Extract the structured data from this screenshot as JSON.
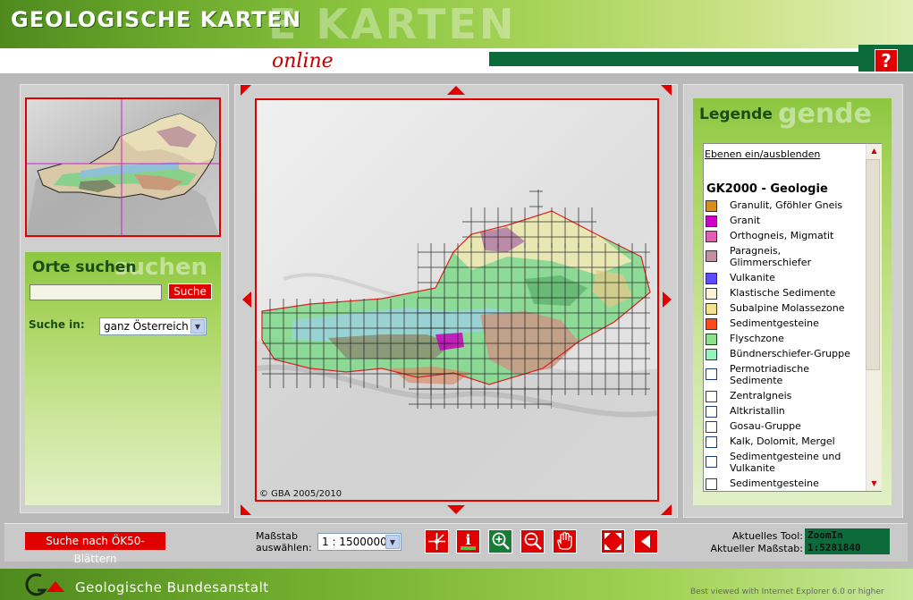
{
  "header": {
    "title": "GEOLOGISCHE KARTEN",
    "title_ghost": "E KARTEN",
    "subtitle": "online",
    "help_label": "?"
  },
  "search": {
    "title": "Orte suchen",
    "title_ghost": "suchen",
    "input_value": "",
    "button_label": "Suche",
    "search_in_label": "Suche in:",
    "region_selected": "ganz Österreich"
  },
  "map": {
    "copyright": "© GBA 2005/2010"
  },
  "legend": {
    "title": "Legende",
    "title_ghost": "gende",
    "toggle_label": "Ebenen ein/ausblenden",
    "layer_title": "GK2000 - Geologie",
    "items": [
      {
        "label": "Granulit, Gföhler Gneis",
        "color": "#d98d1c"
      },
      {
        "label": "Granit",
        "color": "#d100c8"
      },
      {
        "label": "Orthogneis, Migmatit",
        "color": "#e65bb4"
      },
      {
        "label": "Paragneis, Glimmerschiefer",
        "color": "#c88fa3"
      },
      {
        "label": "Vulkanite",
        "color": "#5b4cff"
      },
      {
        "label": "Klastische Sedimente",
        "color": "#fbf3d6"
      },
      {
        "label": "Subalpine Molassezone",
        "color": "#f4e28f"
      },
      {
        "label": "Sedimentgesteine",
        "color": "#ff4a1a"
      },
      {
        "label": "Flyschzone",
        "color": "#8fe08a"
      },
      {
        "label": "Bündnerschiefer-Gruppe",
        "color": "#93f5b9"
      },
      {
        "label": "Permotriadische Sedimente",
        "color": "#ffffff"
      },
      {
        "label": "Zentralgneis",
        "color": "#ffffff"
      },
      {
        "label": "Altkristallin",
        "color": "#ffffff"
      },
      {
        "label": "Gosau-Gruppe",
        "color": "#ffffff"
      },
      {
        "label": "Kalk, Dolomit, Mergel",
        "color": "#ffffff"
      },
      {
        "label": "Sedimentgesteine und Vulkanite",
        "color": "#ffffff"
      },
      {
        "label": "Sedimentgesteine",
        "color": "#ffffff"
      }
    ]
  },
  "toolbar": {
    "oek50_label": "Suche nach ÖK50-Blättern",
    "scale_label_line1": "Maßstab",
    "scale_label_line2": "auswählen:",
    "scale_selected": "1 : 1500000",
    "current_tool_label": "Aktuelles Tool:",
    "current_tool_value": "ZoomIn",
    "current_scale_label": "Aktueller Maßstab:",
    "current_scale_value": "1:5281840"
  },
  "footer": {
    "org_name": "Geologische Bundesanstalt",
    "note": "Best viewed with Internet Explorer 6.0 or higher"
  },
  "colors": {
    "accent_red": "#e00000",
    "dark_green": "#0d6a3a",
    "leaf_green": "#8cc640"
  }
}
